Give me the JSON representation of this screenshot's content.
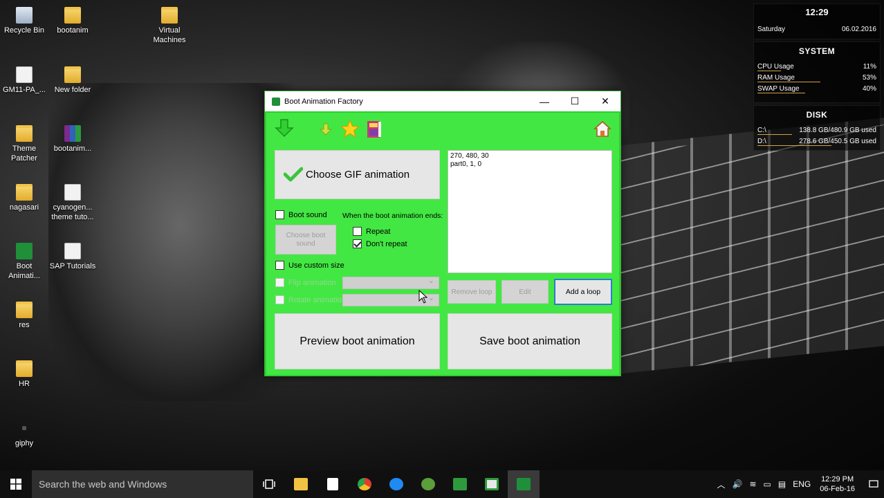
{
  "desktop": {
    "icons": [
      {
        "label": "Recycle Bin"
      },
      {
        "label": "bootanim"
      },
      {
        "label": "Virtual\nMachines"
      },
      {
        "label": "GM11-PA_..."
      },
      {
        "label": "New folder"
      },
      {
        "label": "Theme\nPatcher"
      },
      {
        "label": "bootanim..."
      },
      {
        "label": "nagasari"
      },
      {
        "label": "cyanogen...\ntheme tuto..."
      },
      {
        "label": "Boot\nAnimati..."
      },
      {
        "label": "SAP Tutorials"
      },
      {
        "label": "res"
      },
      {
        "label": "HR"
      },
      {
        "label": "giphy"
      }
    ]
  },
  "widget": {
    "time": "12:29",
    "day": "Saturday",
    "date": "06.02.2016",
    "system_heading": "SYSTEM",
    "cpu_label": "CPU Usage",
    "cpu_value": "11%",
    "ram_label": "RAM Usage",
    "ram_value": "53%",
    "swap_label": "SWAP Usage",
    "swap_value": "40%",
    "disk_heading": "DISK",
    "c_label": "C:\\",
    "c_value": "138.8 GB/480.9 GB used",
    "d_label": "D:\\",
    "d_value": "278.6 GB/450.5 GB used"
  },
  "window": {
    "title": "Boot Animation Factory",
    "minimize": "—",
    "maximize": "☐",
    "close": "✕",
    "choose_gif": "Choose GIF animation",
    "boot_sound": "Boot sound",
    "choose_boot_sound": "Choose boot\nsound",
    "when_ends": "When the boot animation ends:",
    "repeat": "Repeat",
    "dont_repeat": "Don't repeat",
    "use_custom_size": "Use custom size",
    "flip_animation": "Flip animation",
    "rotate_animation": "Rotate animation",
    "desc_text": "270, 480, 30\npart0, 1, 0",
    "remove_loop": "Remove loop",
    "edit": "Edit",
    "add_loop": "Add a loop",
    "preview": "Preview boot animation",
    "save": "Save boot animation",
    "checks": {
      "boot_sound": false,
      "repeat": false,
      "dont_repeat": true,
      "custom_size": false,
      "flip": false,
      "rotate": false
    }
  },
  "taskbar": {
    "search_placeholder": "Search the web and Windows",
    "language": "ENG",
    "time": "12:29 PM",
    "date": "06-Feb-16"
  }
}
